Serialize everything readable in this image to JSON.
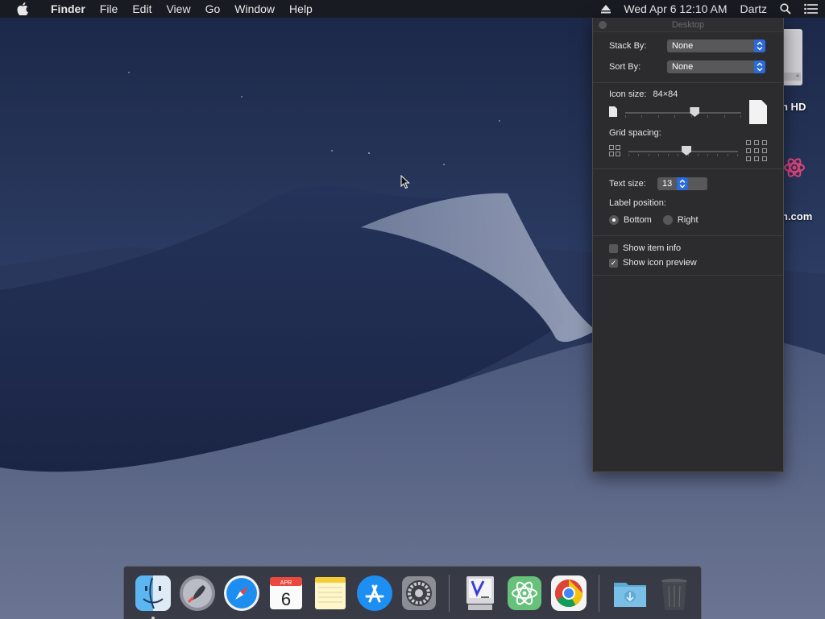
{
  "menubar": {
    "app_name": "Finder",
    "menus": [
      "File",
      "Edit",
      "View",
      "Go",
      "Window",
      "Help"
    ],
    "datetime": "Wed Apr 6  12:10 AM",
    "user": "Dartz"
  },
  "desktop": {
    "icon_labels": [
      "h HD",
      "n.com"
    ]
  },
  "panel": {
    "title": "Desktop",
    "stack_by_label": "Stack By:",
    "stack_by_value": "None",
    "sort_by_label": "Sort By:",
    "sort_by_value": "None",
    "icon_size_label": "Icon size:",
    "icon_size_value": "84×84",
    "icon_size_fraction": 0.6,
    "grid_spacing_label": "Grid spacing:",
    "grid_spacing_fraction": 0.53,
    "text_size_label": "Text size:",
    "text_size_value": "13",
    "label_position_label": "Label position:",
    "label_position_options": [
      "Bottom",
      "Right"
    ],
    "label_position_selected": "Bottom",
    "show_item_info_label": "Show item info",
    "show_item_info_checked": false,
    "show_icon_preview_label": "Show icon preview",
    "show_icon_preview_checked": true
  },
  "dock": {
    "apps": [
      "finder-icon",
      "launchpad-icon",
      "safari-icon",
      "calendar-icon",
      "notes-icon",
      "app-store-icon",
      "system-preferences-icon",
      "vim-icon",
      "atom-icon",
      "chrome-icon",
      "downloads-folder-icon",
      "trash-icon"
    ],
    "calendar_month": "APR",
    "calendar_day": "6"
  },
  "colors": {
    "accent": "#2a6bd8",
    "panel_bg": "#2c2c2e"
  }
}
